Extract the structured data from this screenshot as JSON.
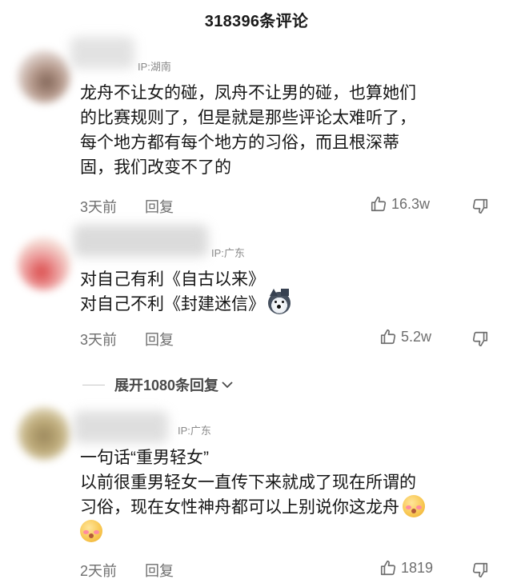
{
  "header": {
    "title": "318396条评论"
  },
  "comments": [
    {
      "ip": "IP:湖南",
      "lines": [
        "龙舟不让女的碰，凤舟不让男的碰，也算她们",
        "的比赛规则了，但是就是那些评论太难听了，",
        "每个地方都有每个地方的习俗，而且根深蒂",
        "固，我们改变不了的"
      ],
      "time": "3天前",
      "reply": "回复",
      "likes": "16.3w",
      "icons": [
        "thumbs-up-icon",
        "thumbs-down-icon"
      ]
    },
    {
      "ip": "IP:广东",
      "lines": [
        "对自己有利《自古以来》",
        "对自己不利《封建迷信》"
      ],
      "emoji": "husky-dog-emoji",
      "time": "3天前",
      "reply": "回复",
      "likes": "5.2w",
      "expand_label": "展开1080条回复"
    },
    {
      "ip": "IP:广东",
      "lines": [
        "一句话“重男轻女”",
        "以前很重男轻女一直传下来就成了现在所谓的",
        "习俗，现在女性神舟都可以上别说你这龙舟"
      ],
      "emoji": "blushing-face-emoji",
      "time": "2天前",
      "reply": "回复",
      "likes": "1819"
    }
  ],
  "colors": {
    "text": "#161616",
    "meta": "#6e6e6e",
    "ip": "#8a8a8a"
  }
}
